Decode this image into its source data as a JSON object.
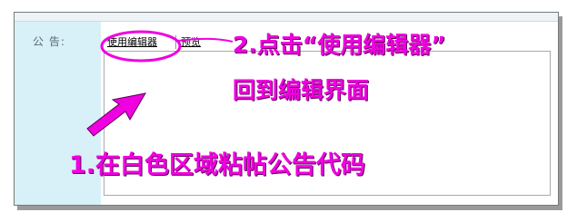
{
  "form": {
    "announcement_label": "公  告:",
    "tabs": {
      "use_editor": "使用编辑器",
      "preview": "预览"
    },
    "editor_value": ""
  },
  "annotations": {
    "step2_line1": "2.点击“使用编辑器”",
    "step2_line2": "回到编辑界面",
    "step1": "1.在白色区域粘帖公告代码"
  },
  "icons": {
    "scroll_up": "scroll-up-arrow-icon",
    "scroll_down": "scroll-down-arrow-icon"
  },
  "colors": {
    "annotation": "#f000e0",
    "label_cell_bg": "#d8f0f8"
  }
}
